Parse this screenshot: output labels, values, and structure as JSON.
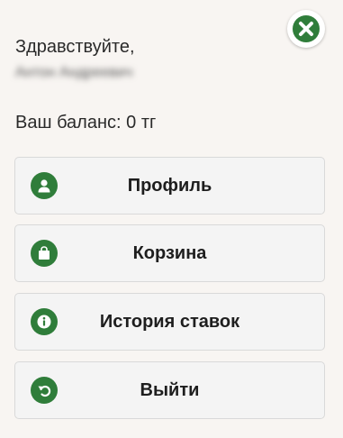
{
  "header": {
    "close_icon": "close-icon",
    "greeting": "Здравствуйте,",
    "user_name": "Антон Андреевич"
  },
  "balance": {
    "label": "Ваш баланс:",
    "amount": "0",
    "currency": "тг"
  },
  "menu": [
    {
      "label": "Профиль",
      "icon": "user-icon"
    },
    {
      "label": "Корзина",
      "icon": "shopping-bag-icon"
    },
    {
      "label": "История ставок",
      "icon": "info-icon"
    },
    {
      "label": "Выйти",
      "icon": "undo-icon"
    }
  ],
  "colors": {
    "accent": "#2f7d3a",
    "background": "#f8f5f2",
    "button_bg": "#f4f4f4",
    "button_border": "#d9d9d9"
  }
}
